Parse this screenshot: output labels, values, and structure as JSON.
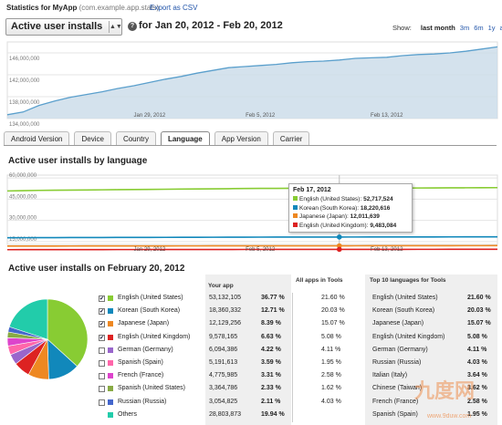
{
  "header": {
    "title": "Statistics for MyApp",
    "package": "(com.example.app.stats)",
    "export_label": "Export as CSV"
  },
  "metric_select": {
    "value": "Active user installs"
  },
  "date_range": "for Jan 20, 2012 - Feb 20, 2012",
  "show": {
    "label": "Show:",
    "options": [
      "last month",
      "3m",
      "6m",
      "1y",
      "all"
    ],
    "selected": "last month"
  },
  "colors": {
    "series_green": "#88cc33",
    "series_blue": "#1188bb",
    "series_orange": "#ee8822",
    "series_red": "#dd2222",
    "area": "#c9dbe8",
    "line": "#5a9fcc"
  },
  "chart_data": [
    {
      "type": "area",
      "title": "",
      "y_ticks": [
        "146,000,000",
        "142,000,000",
        "138,000,000",
        "134,000,000"
      ],
      "x_ticks": [
        "Jan 29, 2012",
        "Feb 5, 2012",
        "Feb 13, 2012"
      ],
      "ylim": [
        134000000,
        148000000
      ],
      "x": [
        0,
        1,
        2,
        3,
        4,
        5,
        6,
        7,
        8,
        9,
        10,
        11,
        12,
        13,
        14,
        15,
        16,
        17,
        18,
        19,
        20,
        21,
        22,
        23,
        24,
        25,
        26,
        27,
        28,
        29,
        30,
        31
      ],
      "values": [
        134700000,
        135200000,
        136400000,
        137200000,
        137900000,
        138400000,
        138900000,
        139500000,
        140000000,
        140600000,
        141200000,
        141700000,
        142300000,
        142800000,
        143300000,
        143500000,
        143700000,
        143900000,
        144200000,
        144400000,
        144500000,
        144700000,
        145000000,
        145100000,
        145200000,
        145500000,
        145700000,
        145800000,
        146000000,
        146300000,
        146700000,
        147100000
      ]
    },
    {
      "type": "line",
      "title": "Active user installs by language",
      "y_ticks": [
        "60,000,000",
        "45,000,000",
        "30,000,000",
        "15,000,000"
      ],
      "x_ticks": [
        "Jan 29, 2012",
        "Feb 5, 2012",
        "Feb 13, 2012"
      ],
      "ylim": [
        13000000,
        62000000
      ],
      "series": [
        {
          "name": "English (United States)",
          "color": "#88cc33",
          "values": [
            50800000,
            51000000,
            51200000,
            51300000,
            51400000,
            51500000,
            51600000,
            51700000,
            51800000,
            51900000,
            52000000,
            52100000,
            52200000,
            52300000,
            52400000,
            52500000,
            52600000,
            52600000,
            52700000,
            52700000,
            52700000,
            52717524,
            52750000,
            52800000,
            52800000,
            52850000,
            52900000,
            52950000,
            53000000,
            53050000,
            53100000,
            53132105
          ]
        },
        {
          "name": "Korean (South Korea)",
          "color": "#1188bb",
          "values": [
            17700000,
            17750000,
            17800000,
            17820000,
            17850000,
            17880000,
            17900000,
            17930000,
            17950000,
            17980000,
            18000000,
            18030000,
            18050000,
            18080000,
            18100000,
            18120000,
            18150000,
            18170000,
            18190000,
            18200000,
            18210000,
            18220616,
            18240000,
            18260000,
            18280000,
            18290000,
            18300000,
            18310000,
            18320000,
            18330000,
            18345000,
            18360332
          ]
        },
        {
          "name": "Japanese (Japan)",
          "color": "#ee8822",
          "values": [
            11800000,
            11810000,
            11830000,
            11850000,
            11870000,
            11880000,
            11900000,
            11910000,
            11920000,
            11930000,
            11940000,
            11950000,
            11960000,
            11970000,
            11980000,
            11990000,
            12000000,
            12005000,
            12008000,
            12010000,
            12011000,
            12011639,
            12030000,
            12050000,
            12060000,
            12070000,
            12080000,
            12090000,
            12100000,
            12110000,
            12120000,
            12129256
          ]
        },
        {
          "name": "English (United Kingdom)",
          "color": "#dd2222",
          "values": [
            9300000,
            9310000,
            9320000,
            9330000,
            9340000,
            9350000,
            9360000,
            9370000,
            9380000,
            9390000,
            9400000,
            9410000,
            9420000,
            9430000,
            9440000,
            9450000,
            9460000,
            9465000,
            9470000,
            9475000,
            9480000,
            9483084,
            9490000,
            9500000,
            9510000,
            9520000,
            9530000,
            9540000,
            9550000,
            9560000,
            9570000,
            9578165
          ]
        }
      ]
    },
    {
      "type": "pie",
      "title": "Active user installs on February 20, 2012",
      "categories": [
        "English (United States)",
        "Korean (South Korea)",
        "Japanese (Japan)",
        "English (United Kingdom)",
        "German (Germany)",
        "Spanish (Spain)",
        "French (France)",
        "Spanish (United States)",
        "Russian (Russia)",
        "Others"
      ],
      "values": [
        36.77,
        12.71,
        8.39,
        6.63,
        4.22,
        3.59,
        3.31,
        2.33,
        2.11,
        19.94
      ],
      "colors": [
        "#88cc33",
        "#1188bb",
        "#ee8822",
        "#dd2222",
        "#9966cc",
        "#ff66aa",
        "#dd44cc",
        "#88aa44",
        "#4466cc",
        "#22ccaa"
      ]
    }
  ],
  "tabs": [
    "Android Version",
    "Device",
    "Country",
    "Language",
    "App Version",
    "Carrier"
  ],
  "active_tab": "Language",
  "tooltip": {
    "date": "Feb 17, 2012",
    "rows": [
      {
        "label": "English (United States):",
        "value": "52,717,524"
      },
      {
        "label": "Korean (South Korea):",
        "value": "18,220,616"
      },
      {
        "label": "Japanese (Japan):",
        "value": "12,011,639"
      },
      {
        "label": "English (United Kingdom):",
        "value": "9,483,084"
      }
    ]
  },
  "table": {
    "col_your_app": "Your app",
    "col_all_apps": "All apps in Tools",
    "col_top10": "Top 10 languages for Tools",
    "rows": [
      {
        "checked": true,
        "lang": "English (United States)",
        "count": "53,132,105",
        "pct": "36.77 %",
        "all": "21.60 %",
        "top_lang": "English (United States)",
        "top_pct": "21.60 %"
      },
      {
        "checked": true,
        "lang": "Korean (South Korea)",
        "count": "18,360,332",
        "pct": "12.71 %",
        "all": "20.03 %",
        "top_lang": "Korean (South Korea)",
        "top_pct": "20.03 %"
      },
      {
        "checked": true,
        "lang": "Japanese (Japan)",
        "count": "12,129,256",
        "pct": "8.39 %",
        "all": "15.07 %",
        "top_lang": "Japanese (Japan)",
        "top_pct": "15.07 %"
      },
      {
        "checked": true,
        "lang": "English (United Kingdom)",
        "count": "9,578,165",
        "pct": "6.63 %",
        "all": "5.08 %",
        "top_lang": "English (United Kingdom)",
        "top_pct": "5.08 %"
      },
      {
        "checked": false,
        "lang": "German (Germany)",
        "count": "6,094,386",
        "pct": "4.22 %",
        "all": "4.11 %",
        "top_lang": "German (Germany)",
        "top_pct": "4.11 %"
      },
      {
        "checked": false,
        "lang": "Spanish (Spain)",
        "count": "5,191,613",
        "pct": "3.59 %",
        "all": "1.95 %",
        "top_lang": "Russian (Russia)",
        "top_pct": "4.03 %"
      },
      {
        "checked": false,
        "lang": "French (France)",
        "count": "4,775,985",
        "pct": "3.31 %",
        "all": "2.58 %",
        "top_lang": "Italian (Italy)",
        "top_pct": "3.64 %"
      },
      {
        "checked": false,
        "lang": "Spanish (United States)",
        "count": "3,364,786",
        "pct": "2.33 %",
        "all": "1.62 %",
        "top_lang": "Chinese (Taiwan)",
        "top_pct": "3.62 %"
      },
      {
        "checked": false,
        "lang": "Russian (Russia)",
        "count": "3,054,825",
        "pct": "2.11 %",
        "all": "4.03 %",
        "top_lang": "French (France)",
        "top_pct": "2.58 %"
      },
      {
        "checked": false,
        "lang": "Others",
        "count": "28,803,873",
        "pct": "19.94 %",
        "all": "",
        "top_lang": "Spanish (Spain)",
        "top_pct": "1.95 %"
      }
    ]
  },
  "watermark": {
    "text": "九度网",
    "url": "www.9duw.com"
  }
}
